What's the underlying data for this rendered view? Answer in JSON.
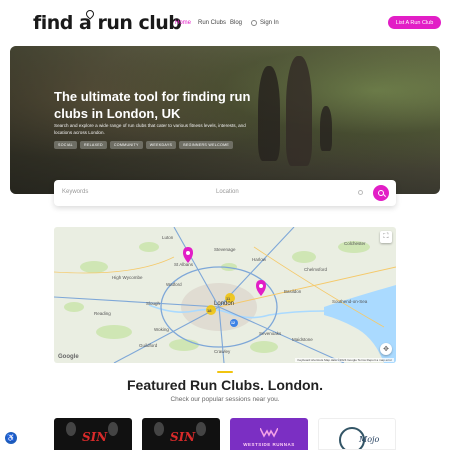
{
  "brand": {
    "logo_text": "find a run club",
    "accent": "#e21ec6"
  },
  "nav": {
    "items": [
      {
        "label": "Home",
        "active": true
      },
      {
        "label": "Run Clubs"
      },
      {
        "label": "Blog"
      }
    ],
    "sign_in": "Sign In",
    "cta": "List A Run Club"
  },
  "hero": {
    "title": "The ultimate tool for finding run clubs in London, UK",
    "subtitle": "Search and explore a wide range of run clubs that cater to various fitness levels, interests, and locations across London.",
    "tags": [
      "SOCIAL",
      "RELAXED",
      "COMMUNITY",
      "WEEKDAYS",
      "BEGINNERS WELCOME"
    ]
  },
  "search": {
    "keywords_placeholder": "Keywords",
    "location_placeholder": "Location"
  },
  "map": {
    "labels": {
      "london": "London",
      "luton": "Luton",
      "stalbans": "St Albans",
      "chelmsford": "Chelmsford",
      "southend": "Southend-on-Sea",
      "reading": "Reading",
      "guildford": "Guildford",
      "crawley": "Crawley",
      "maidstone": "Maidstone",
      "basildon": "Basildon",
      "watford": "Watford",
      "slough": "Slough",
      "harlow": "Harlow",
      "stevenage": "Stevenage",
      "colchester": "Colchester",
      "high_wycombe": "High Wycombe",
      "woking": "Woking",
      "sevenoaks": "Sevenoaks"
    },
    "cluster_labels": [
      "11",
      "18",
      "12"
    ],
    "logo": "Google",
    "attribution": "Keyboard shortcuts   Map data ©2024 Google   Terms   Report a map error"
  },
  "featured": {
    "title": "Featured Run Clubs. London.",
    "subtitle": "Check our popular sessions near you.",
    "cards": [
      {
        "logo_text": "SIN"
      },
      {
        "logo_text": "SIN"
      },
      {
        "logo_text": "WESTSIDE RUNNAS"
      },
      {
        "logo_text": "Mojo"
      }
    ]
  }
}
